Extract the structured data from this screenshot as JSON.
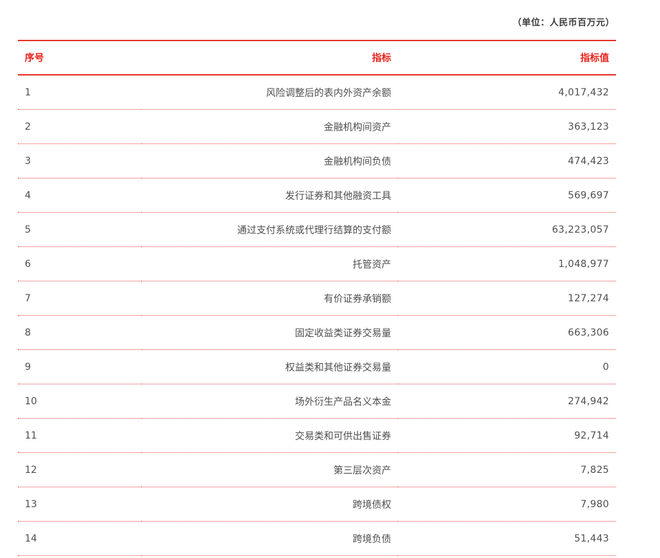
{
  "unit_note": "（单位：人民币百万元）",
  "table": {
    "headers": {
      "index": "序号",
      "indicator": "指标",
      "value": "指标值"
    },
    "rows": [
      {
        "index": "1",
        "indicator": "风险调整后的表内外资产余额",
        "value": "4,017,432"
      },
      {
        "index": "2",
        "indicator": "金融机构间资产",
        "value": "363,123"
      },
      {
        "index": "3",
        "indicator": "金融机构间负债",
        "value": "474,423"
      },
      {
        "index": "4",
        "indicator": "发行证券和其他融资工具",
        "value": "569,697"
      },
      {
        "index": "5",
        "indicator": "通过支付系统或代理行结算的支付额",
        "value": "63,223,057"
      },
      {
        "index": "6",
        "indicator": "托管资产",
        "value": "1,048,977"
      },
      {
        "index": "7",
        "indicator": "有价证券承销额",
        "value": "127,274"
      },
      {
        "index": "8",
        "indicator": "固定收益类证券交易量",
        "value": "663,306"
      },
      {
        "index": "9",
        "indicator": "权益类和其他证券交易量",
        "value": "0"
      },
      {
        "index": "10",
        "indicator": "场外衍生产品名义本金",
        "value": "274,942"
      },
      {
        "index": "11",
        "indicator": "交易类和可供出售证券",
        "value": "92,714"
      },
      {
        "index": "12",
        "indicator": "第三层次资产",
        "value": "7,825"
      },
      {
        "index": "13",
        "indicator": "跨境债权",
        "value": "7,980"
      },
      {
        "index": "14",
        "indicator": "跨境负债",
        "value": "51,443"
      }
    ]
  }
}
